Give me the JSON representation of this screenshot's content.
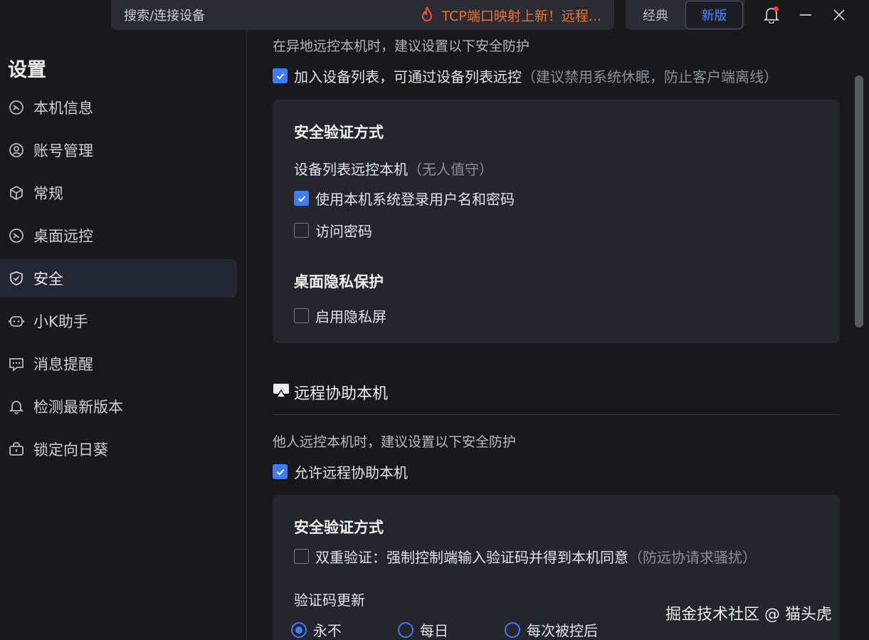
{
  "topbar": {
    "search_label": "搜索/连接设备",
    "promo_text": "TCP端口映射上新！远程...",
    "promo_icon": "fire-icon",
    "mode_classic": "经典",
    "mode_new": "新版",
    "accent_color": "#3d7bff",
    "promo_color": "#e8742e"
  },
  "sidebar": {
    "title": "设置",
    "items": [
      {
        "label": "本机信息",
        "icon": "device-info-icon"
      },
      {
        "label": "账号管理",
        "icon": "user-account-icon"
      },
      {
        "label": "常规",
        "icon": "cube-icon"
      },
      {
        "label": "桌面远控",
        "icon": "remote-desktop-icon"
      },
      {
        "label": "安全",
        "icon": "shield-icon",
        "active": true
      },
      {
        "label": "小K助手",
        "icon": "robot-icon"
      },
      {
        "label": "消息提醒",
        "icon": "message-icon"
      },
      {
        "label": "检测最新版本",
        "icon": "bell-update-icon"
      },
      {
        "label": "锁定向日葵",
        "icon": "lock-box-icon"
      }
    ]
  },
  "main": {
    "cut_off_text": "在异地远控本机时，建议设置以下安全防护",
    "add_device_list": {
      "label": "加入设备列表，可通过设备列表远控",
      "hint": "（建议禁用系统休眠，防止客户端离线）",
      "checked": true
    },
    "card1": {
      "title": "安全验证方式",
      "sub_label": "设备列表远控本机",
      "sub_hint": "（无人值守）",
      "opt_system_login": {
        "label": "使用本机系统登录用户名和密码",
        "checked": true
      },
      "opt_access_password": {
        "label": "访问密码",
        "checked": false
      },
      "privacy_title": "桌面隐私保护",
      "opt_privacy_screen": {
        "label": "启用隐私屏",
        "checked": false
      }
    },
    "assist_section": {
      "title": "远程协助本机",
      "icon": "screen-share-icon",
      "description": "他人远控本机时，建议设置以下安全防护",
      "allow_assist": {
        "label": "允许远程协助本机",
        "checked": true
      }
    },
    "card2": {
      "title": "安全验证方式",
      "two_factor": {
        "label": "双重验证：强制控制端输入验证码并得到本机同意",
        "hint": "（防远协请求骚扰）",
        "checked": false
      },
      "code_update_label": "验证码更新",
      "code_update_options": [
        {
          "label": "永不",
          "selected": true
        },
        {
          "label": "每日",
          "selected": false
        },
        {
          "label": "每次被控后",
          "selected": false
        }
      ]
    }
  },
  "watermark": "掘金技术社区 @ 猫头虎"
}
